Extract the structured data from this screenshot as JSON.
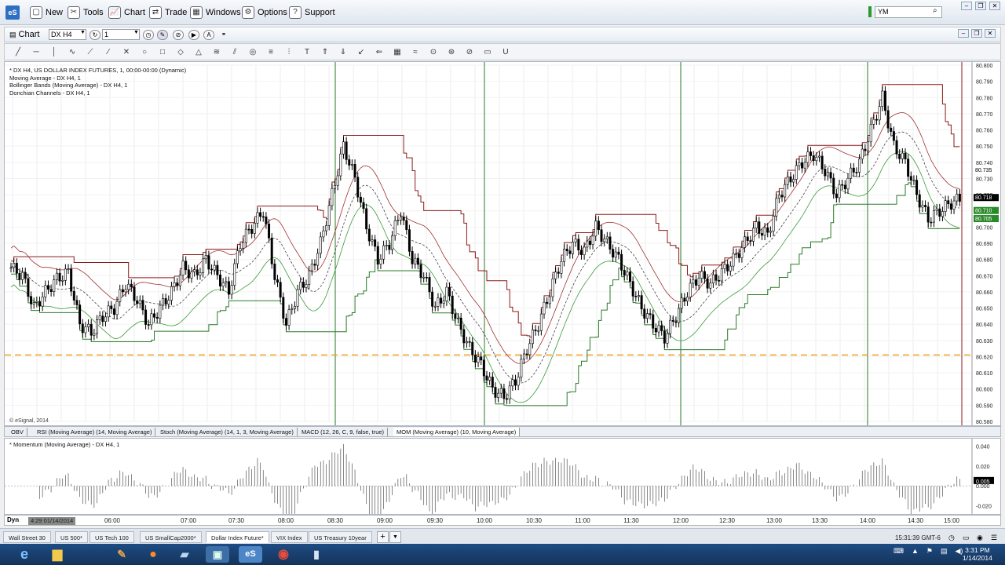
{
  "menubar": {
    "logo": "eS",
    "items": [
      {
        "label": "New",
        "icon": "new-icon",
        "glyph": "▢"
      },
      {
        "label": "Tools",
        "icon": "tools-icon",
        "glyph": "✂"
      },
      {
        "label": "Chart",
        "icon": "chart-icon",
        "glyph": "📈"
      },
      {
        "label": "Trade",
        "icon": "trade-icon",
        "glyph": "⇄"
      },
      {
        "label": "Windows",
        "icon": "windows-icon",
        "glyph": "▦"
      },
      {
        "label": "Options",
        "icon": "options-icon",
        "glyph": "⚙"
      },
      {
        "label": "Support",
        "icon": "support-icon",
        "glyph": "?"
      }
    ],
    "symbol_value": "YM"
  },
  "chart_window": {
    "title": "Chart",
    "symbol": "DX H4",
    "interval": "1"
  },
  "legend": [
    "* DX H4, US DOLLAR INDEX FUTURES, 1, 00:00-00:00 (Dynamic)",
    "Moving Average - DX H4, 1",
    "Bollinger Bands (Moving Average) - DX H4, 1",
    "Donchian Channels - DX H4, 1"
  ],
  "copyright": "© eSignal, 2014",
  "indicator_tabs": [
    "OBV",
    "RSI (Moving Average) (14, Moving Average)",
    "Stoch (Moving Average) (14, 1, 3, Moving Average)",
    "MACD (12, 26, C, 9, false, true)",
    "MOM (Moving Average) (10, Moving Average)"
  ],
  "momentum_legend": "* Momentum (Moving Average) - DX H4, 1",
  "time_axis": {
    "dyn": "Dyn",
    "date": "4:29 01/14/2014",
    "labels": [
      "06:00",
      "07:00",
      "07:30",
      "08:00",
      "08:30",
      "09:00",
      "09:30",
      "10:00",
      "10:30",
      "11:00",
      "11:30",
      "12:00",
      "12:30",
      "13:00",
      "13:30",
      "14:00",
      "14:30",
      "15:00"
    ]
  },
  "page_tabs": [
    "Wall Street 30",
    "US 500*",
    "US Tech 100",
    "US SmallCap2000*",
    "Dollar Index Future*",
    "VIX Index",
    "US Treasury 10year"
  ],
  "active_page_tab": "Dollar Index Future*",
  "status_clock": "15:31:39 GMT-6",
  "taskbar": {
    "time": "3:31 PM",
    "date": "1/14/2014"
  },
  "chart_data": {
    "type": "candlestick",
    "price_axis_labels": [
      "80.800",
      "80.790",
      "80.780",
      "80.770",
      "80.760",
      "80.750",
      "80.740",
      "80.730",
      "80.720",
      "80.710",
      "80.700",
      "80.690",
      "80.680",
      "80.670",
      "80.660",
      "80.650",
      "80.640",
      "80.630",
      "80.620",
      "80.610",
      "80.600",
      "80.590",
      "80.580"
    ],
    "ylim": [
      80.58,
      80.8
    ],
    "price_tags": [
      {
        "value": "80.735",
        "color": "#ffffff"
      },
      {
        "value": "80.718",
        "color": "#000000"
      },
      {
        "value": "80.710",
        "color": "#2a8a2a"
      },
      {
        "value": "80.705",
        "color": "#2a8a2a"
      }
    ],
    "reference_line": 80.621,
    "momentum_axis_labels": [
      "0.040",
      "0.020",
      "0.005",
      "0.000",
      "-0.020"
    ],
    "momentum_ylim": [
      -0.025,
      0.045
    ],
    "close_path": [
      80.675,
      80.67,
      80.65,
      80.66,
      80.668,
      80.672,
      80.64,
      80.635,
      80.645,
      80.65,
      80.665,
      80.655,
      80.64,
      80.65,
      80.66,
      80.675,
      80.67,
      80.68,
      80.67,
      80.66,
      80.69,
      80.7,
      80.71,
      80.67,
      80.64,
      80.66,
      80.67,
      80.69,
      80.72,
      80.75,
      80.73,
      80.7,
      80.68,
      80.69,
      80.71,
      80.68,
      80.67,
      80.65,
      80.66,
      80.64,
      80.625,
      80.615,
      80.6,
      80.595,
      80.605,
      80.625,
      80.64,
      80.66,
      80.68,
      80.69,
      80.685,
      80.7,
      80.69,
      80.68,
      80.665,
      80.65,
      80.64,
      80.632,
      80.645,
      80.66,
      80.67,
      80.665,
      80.672,
      80.68,
      80.69,
      80.7,
      80.695,
      80.72,
      80.73,
      80.74,
      80.745,
      80.735,
      80.72,
      80.73,
      80.74,
      80.76,
      80.78,
      80.75,
      80.74,
      80.72,
      80.705,
      80.71,
      80.715,
      80.718
    ]
  }
}
